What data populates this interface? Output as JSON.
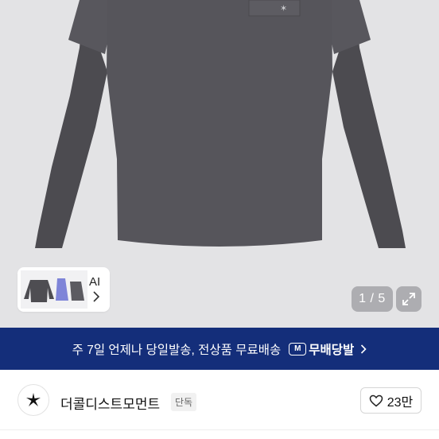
{
  "product_gallery": {
    "alt_label": "AI",
    "counter": "1 / 5",
    "current_image": 1,
    "total_images": 5
  },
  "shipping_banner": {
    "text": "주 7일 언제나 당일발송, 전상품 무료배송",
    "badge_icon_text": "M",
    "badge_label": "무배당발"
  },
  "brand": {
    "name": "더콜디스트모먼트",
    "tag": "단독",
    "likes": "23만"
  },
  "colors": {
    "banner_bg": "#142e7a",
    "garment": "#55545a",
    "hero_bg": "#e3e3e5"
  }
}
